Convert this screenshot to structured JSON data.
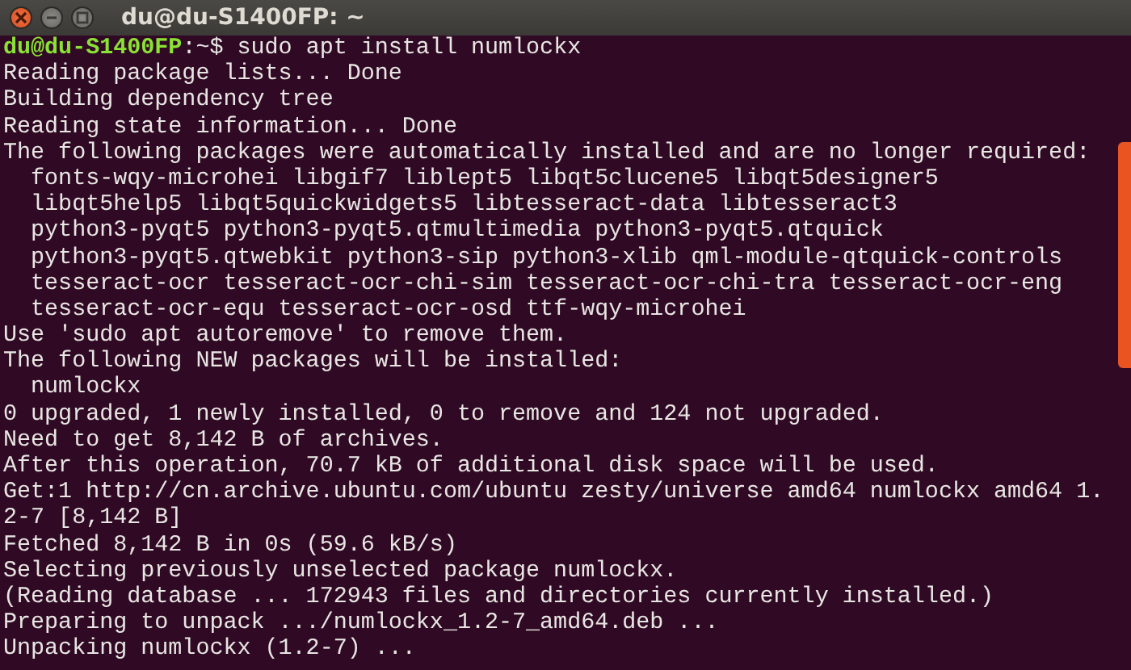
{
  "window": {
    "title": "du@du-S1400FP: ~"
  },
  "lines": [
    {
      "kind": "prompt",
      "user_host": "du@du-S1400FP",
      "path": ":~$",
      "command": "sudo apt install numlockx"
    },
    {
      "kind": "output",
      "text": "Reading package lists... Done"
    },
    {
      "kind": "output",
      "text": "Building dependency tree"
    },
    {
      "kind": "output",
      "text": "Reading state information... Done"
    },
    {
      "kind": "output",
      "text": "The following packages were automatically installed and are no longer required:"
    },
    {
      "kind": "output",
      "text": "  fonts-wqy-microhei libgif7 liblept5 libqt5clucene5 libqt5designer5"
    },
    {
      "kind": "output",
      "text": "  libqt5help5 libqt5quickwidgets5 libtesseract-data libtesseract3"
    },
    {
      "kind": "output",
      "text": "  python3-pyqt5 python3-pyqt5.qtmultimedia python3-pyqt5.qtquick"
    },
    {
      "kind": "output",
      "text": "  python3-pyqt5.qtwebkit python3-sip python3-xlib qml-module-qtquick-controls"
    },
    {
      "kind": "output",
      "text": "  tesseract-ocr tesseract-ocr-chi-sim tesseract-ocr-chi-tra tesseract-ocr-eng"
    },
    {
      "kind": "output",
      "text": "  tesseract-ocr-equ tesseract-ocr-osd ttf-wqy-microhei"
    },
    {
      "kind": "output",
      "text": "Use 'sudo apt autoremove' to remove them."
    },
    {
      "kind": "output",
      "text": "The following NEW packages will be installed:"
    },
    {
      "kind": "output",
      "text": "  numlockx"
    },
    {
      "kind": "output",
      "text": "0 upgraded, 1 newly installed, 0 to remove and 124 not upgraded."
    },
    {
      "kind": "output",
      "text": "Need to get 8,142 B of archives."
    },
    {
      "kind": "output",
      "text": "After this operation, 70.7 kB of additional disk space will be used."
    },
    {
      "kind": "output",
      "text": "Get:1 http://cn.archive.ubuntu.com/ubuntu zesty/universe amd64 numlockx amd64 1."
    },
    {
      "kind": "output",
      "text": "2-7 [8,142 B]"
    },
    {
      "kind": "output",
      "text": "Fetched 8,142 B in 0s (59.6 kB/s)"
    },
    {
      "kind": "output",
      "text": "Selecting previously unselected package numlockx."
    },
    {
      "kind": "output",
      "text": "(Reading database ... 172943 files and directories currently installed.)"
    },
    {
      "kind": "output",
      "text": "Preparing to unpack .../numlockx_1.2-7_amd64.deb ..."
    },
    {
      "kind": "output",
      "text": "Unpacking numlockx (1.2-7) ..."
    }
  ]
}
